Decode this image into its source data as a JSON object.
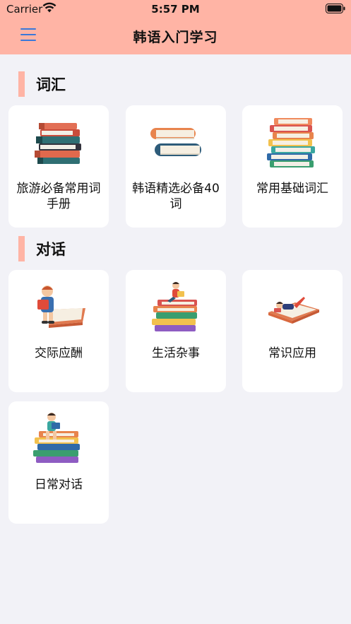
{
  "status_bar": {
    "carrier": "Carrier",
    "time": "5:57 PM"
  },
  "nav": {
    "title": "韩语入门学习",
    "menu_icon": "hamburger-menu-icon"
  },
  "sections": [
    {
      "title": "词汇",
      "cards": [
        {
          "label": "旅游必备常用词手册",
          "icon": "book-stack-icon"
        },
        {
          "label": "韩语精选必备40词",
          "icon": "two-books-icon"
        },
        {
          "label": "常用基础词汇",
          "icon": "colorful-book-stack-icon"
        }
      ]
    },
    {
      "title": "对话",
      "cards": [
        {
          "label": "交际应酬",
          "icon": "child-reading-icon"
        },
        {
          "label": "生活杂事",
          "icon": "person-on-books-icon"
        },
        {
          "label": "常识应用",
          "icon": "person-lying-on-book-icon"
        },
        {
          "label": "日常对话",
          "icon": "child-sitting-on-books-icon"
        }
      ]
    }
  ],
  "colors": {
    "accent": "#ffb4a5",
    "background": "#f2f2f7",
    "menu": "#3a78d9"
  }
}
